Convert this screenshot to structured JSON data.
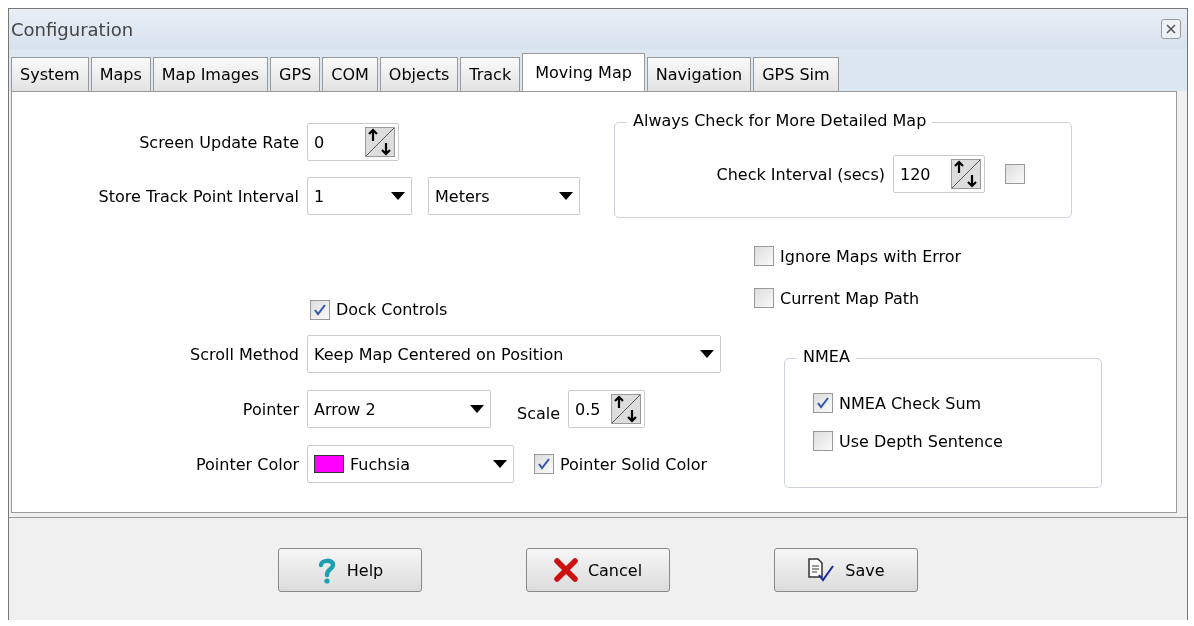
{
  "window": {
    "title": "Configuration"
  },
  "tabs": [
    {
      "label": "System",
      "selected": false
    },
    {
      "label": "Maps",
      "selected": false
    },
    {
      "label": "Map Images",
      "selected": false
    },
    {
      "label": "GPS",
      "selected": false
    },
    {
      "label": "COM",
      "selected": false
    },
    {
      "label": "Objects",
      "selected": false
    },
    {
      "label": "Track",
      "selected": false
    },
    {
      "label": "Moving Map",
      "selected": true
    },
    {
      "label": "Navigation",
      "selected": false
    },
    {
      "label": "GPS Sim",
      "selected": false
    }
  ],
  "screen_update_rate": {
    "label": "Screen Update Rate",
    "value": "0"
  },
  "store_track_point_interval": {
    "label": "Store Track Point Interval",
    "value": "1",
    "unit": "Meters"
  },
  "detailed_map_group": {
    "title": "Always Check for More Detailed Map",
    "check_interval_label": "Check Interval (secs)",
    "check_interval_value": "120",
    "checked": false
  },
  "ignore_maps_with_error": {
    "label": "Ignore Maps with Error",
    "checked": false
  },
  "current_map_path": {
    "label": "Current Map Path",
    "checked": false
  },
  "dock_controls": {
    "label": "Dock Controls",
    "checked": true
  },
  "scroll_method": {
    "label": "Scroll Method",
    "value": "Keep Map Centered on Position"
  },
  "pointer": {
    "label": "Pointer",
    "value": "Arrow 2"
  },
  "scale": {
    "label": "Scale",
    "value": "0.5"
  },
  "pointer_color": {
    "label": "Pointer Color",
    "value": "Fuchsia",
    "color": "#ff00ff"
  },
  "pointer_solid_color": {
    "label": "Pointer Solid Color",
    "checked": true
  },
  "nmea_group": {
    "title": "NMEA",
    "options": [
      {
        "label": "NMEA Check Sum",
        "checked": true
      },
      {
        "label": "Use Depth Sentence",
        "checked": false
      }
    ]
  },
  "buttons": [
    {
      "kind": "help",
      "label": "Help"
    },
    {
      "kind": "cancel",
      "label": "Cancel"
    },
    {
      "kind": "save",
      "label": "Save"
    }
  ]
}
